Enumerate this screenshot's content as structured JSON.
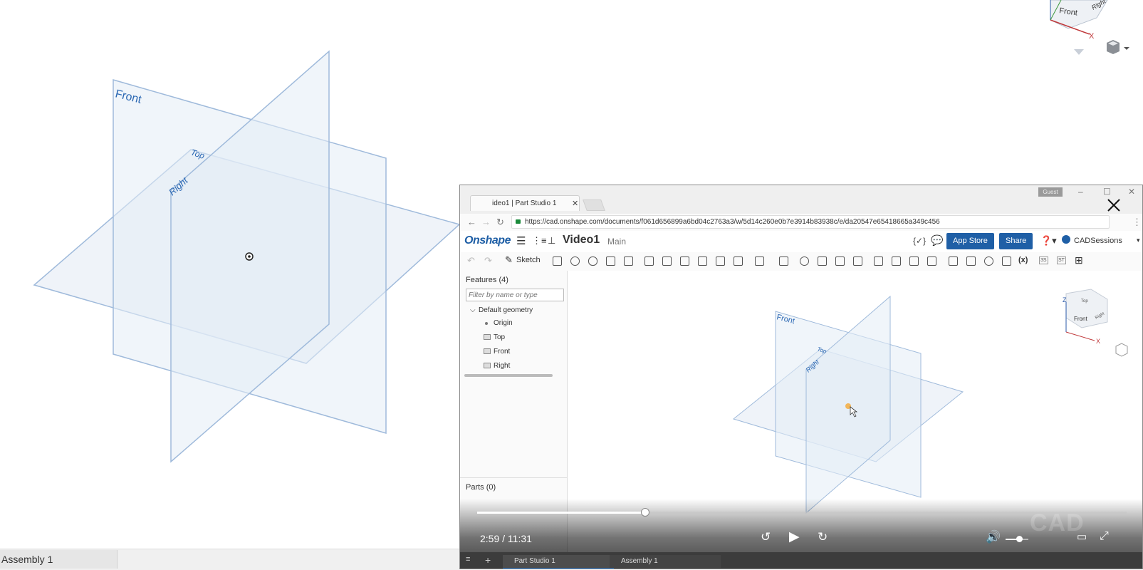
{
  "main_view": {
    "planes": {
      "front": "Front",
      "top": "Top",
      "right": "Right"
    },
    "axis_labels": {
      "x": "X"
    },
    "navcube_face": "Front",
    "navcube_right": "Right",
    "bottom_tab": "Assembly 1"
  },
  "video": {
    "browser_tab_title": "ideo1 | Part Studio 1",
    "guest_badge": "Guest",
    "url": "https://cad.onshape.com/documents/f061d656899a6bd04c2763a3/w/5d14c260e0b7e3914b83938c/e/da20547e65418665a349c456",
    "app": {
      "logo": "Onshape",
      "document_name": "Video1",
      "branch": "Main",
      "app_store_label": "App Store",
      "share_label": "Share",
      "user_name": "CADSessions"
    },
    "toolbar": {
      "sketch_label": "Sketch",
      "right_labels": [
        "3S",
        "ST"
      ]
    },
    "feature_tree": {
      "heading": "Features (4)",
      "filter_placeholder": "Filter by name or type",
      "group": "Default geometry",
      "items": [
        "Origin",
        "Top",
        "Front",
        "Right"
      ],
      "parts_heading": "Parts (0)"
    },
    "viewport": {
      "planes": {
        "front": "Front",
        "top": "Top",
        "right": "Right"
      },
      "navcube": {
        "z": "Z",
        "x": "X",
        "top": "Top",
        "front": "Front",
        "right": "Right"
      }
    },
    "player": {
      "current_time": "2:59",
      "duration": "11:31",
      "time_display": "2:59 / 11:31",
      "progress": 0.259,
      "volume": 0.6,
      "watermark": "CAD"
    },
    "taskbar": {
      "tabs": [
        "Part Studio 1",
        "Assembly 1"
      ]
    }
  },
  "colors": {
    "plane_fill": "#e8eef7",
    "plane_stroke": "#9fbadb",
    "plane_label": "#2a67b3",
    "onshape_blue": "#1f5fa6"
  }
}
